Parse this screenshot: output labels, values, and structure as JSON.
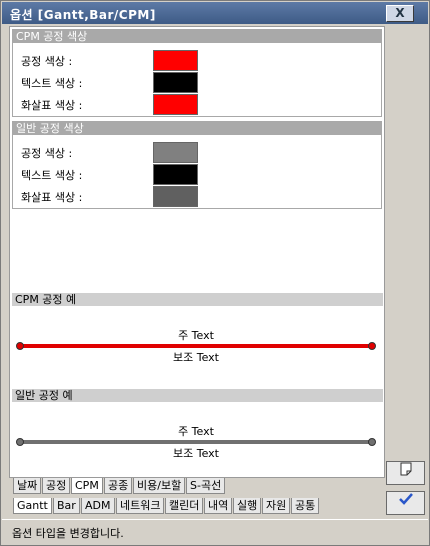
{
  "window": {
    "title": "옵션 [Gantt,Bar/CPM]",
    "close_label": "X"
  },
  "cpm_group": {
    "header": "CPM 공정 색상",
    "rows": [
      {
        "label": "공정 색상 :",
        "color": "#ff0000"
      },
      {
        "label": "텍스트 색상 :",
        "color": "#000000"
      },
      {
        "label": "화살표 색상 :",
        "color": "#ff0000"
      }
    ]
  },
  "normal_group": {
    "header": "일반 공정 색상",
    "rows": [
      {
        "label": "공정 색상 :",
        "color": "#808080"
      },
      {
        "label": "텍스트 색상 :",
        "color": "#000000"
      },
      {
        "label": "화살표 색상 :",
        "color": "#606060"
      }
    ]
  },
  "cpm_example": {
    "header": "CPM 공정 예",
    "main_text": "주 Text",
    "sub_text": "보조 Text",
    "color": "#e00000"
  },
  "normal_example": {
    "header": "일반 공정 예",
    "main_text": "주 Text",
    "sub_text": "보조 Text",
    "color": "#707070"
  },
  "tabs_upper": [
    "날짜",
    "공정",
    "CPM",
    "공종",
    "비용/보할",
    "S-곡선"
  ],
  "tabs_upper_active": "CPM",
  "tabs_lower": [
    "Gantt",
    "Bar",
    "ADM",
    "네트워크",
    "캘린더",
    "내역",
    "실행",
    "자원",
    "공통"
  ],
  "tabs_lower_active": "Gantt",
  "status": "옵션 타입을 변경합니다.",
  "side_buttons": {
    "note_icon": "note-icon",
    "apply_icon": "check-icon"
  }
}
